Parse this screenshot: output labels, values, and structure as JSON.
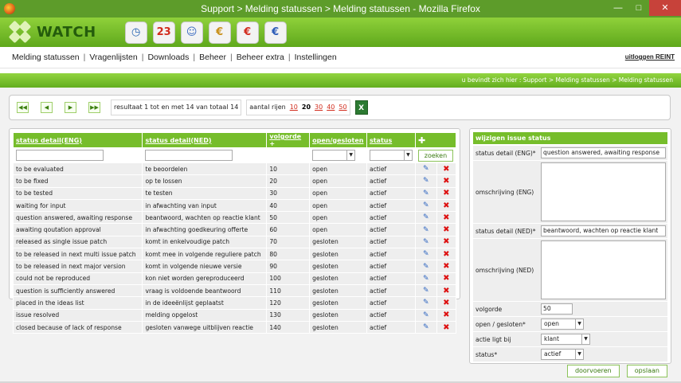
{
  "window": {
    "title": "Support > Melding statussen > Melding statussen - Mozilla Firefox"
  },
  "app": {
    "logo_text": "WATCH"
  },
  "app_icons": [
    {
      "name": "clock-icon",
      "glyph": "◷",
      "color": "#1e5fb0"
    },
    {
      "name": "calendar-icon",
      "glyph": "23",
      "color": "#d22b1d"
    },
    {
      "name": "users-icon",
      "glyph": "☺",
      "color": "#3a6ac0"
    },
    {
      "name": "euro-coins-icon",
      "glyph": "€",
      "color": "#c9901a"
    },
    {
      "name": "euro-refresh-icon",
      "glyph": "€",
      "color": "#d22b1d"
    },
    {
      "name": "euro-calculator-icon",
      "glyph": "€",
      "color": "#2d5cb8"
    }
  ],
  "menu": [
    "Melding statussen",
    "Vragenlijsten",
    "Downloads",
    "Beheer",
    "Beheer extra",
    "Instellingen"
  ],
  "logout": "uitloggen REINT",
  "breadcrumb": "u bevindt zich hier : Support > Melding statussen > Melding statussen",
  "pager": {
    "info": "resultaat 1 tot en met 14 van totaal 14",
    "rows_label": "aantal rijen",
    "rows_options": [
      "10",
      "20",
      "30",
      "40",
      "50"
    ],
    "rows_selected": "20",
    "excel_label": "X"
  },
  "table": {
    "headers": [
      "status detail(ENG)",
      "status detail(NED)",
      "volgorde",
      "open/gesloten",
      "status"
    ],
    "sort_marker": "+",
    "add_glyph": "✚",
    "search_label": "zoeken",
    "edit_glyph": "✎",
    "delete_glyph": "✖",
    "rows": [
      [
        "to be evaluated",
        "te beoordelen",
        "10",
        "open",
        "actief"
      ],
      [
        "to be fixed",
        "op te lossen",
        "20",
        "open",
        "actief"
      ],
      [
        "to be tested",
        "te testen",
        "30",
        "open",
        "actief"
      ],
      [
        "waiting for input",
        "in afwachting van input",
        "40",
        "open",
        "actief"
      ],
      [
        "question answered, awaiting response",
        "beantwoord, wachten op reactie klant",
        "50",
        "open",
        "actief"
      ],
      [
        "awaiting qoutation approval",
        "in afwachting goedkeuring offerte",
        "60",
        "open",
        "actief"
      ],
      [
        "released as single issue patch",
        "komt in enkelvoudige patch",
        "70",
        "gesloten",
        "actief"
      ],
      [
        "to be released in next multi issue patch",
        "komt mee in volgende reguliere patch",
        "80",
        "gesloten",
        "actief"
      ],
      [
        "to be released in next major version",
        "komt in volgende nieuwe versie",
        "90",
        "gesloten",
        "actief"
      ],
      [
        "could not be reproduced",
        "kon niet worden gereproduceerd",
        "100",
        "gesloten",
        "actief"
      ],
      [
        "question is sufficiently answered",
        "vraag is voldoende beantwoord",
        "110",
        "gesloten",
        "actief"
      ],
      [
        "placed in the ideas list",
        "in de ideeënlijst geplaatst",
        "120",
        "gesloten",
        "actief"
      ],
      [
        "issue resolved",
        "melding opgelost",
        "130",
        "gesloten",
        "actief"
      ],
      [
        "closed because of lack of response",
        "gesloten vanwege uitblijven reactie",
        "140",
        "gesloten",
        "actief"
      ]
    ]
  },
  "form": {
    "title": "wijzigen issue status",
    "labels": {
      "detail_eng": "status detail (ENG)*",
      "omschrijving_eng": "omschrijving (ENG)",
      "detail_ned": "status detail (NED)*",
      "omschrijving_ned": "omschrijving (NED)",
      "volgorde": "volgorde",
      "open_gesloten": "open / gesloten*",
      "actie": "actie ligt bij",
      "status": "status*"
    },
    "values": {
      "detail_eng": "question answered, awaiting response",
      "detail_ned": "beantwoord, wachten op reactie klant",
      "volgorde": "50",
      "open_gesloten": "open",
      "actie": "klant",
      "status": "actief"
    },
    "buttons": {
      "save_continue": "doorvoeren",
      "save": "opslaan"
    }
  }
}
